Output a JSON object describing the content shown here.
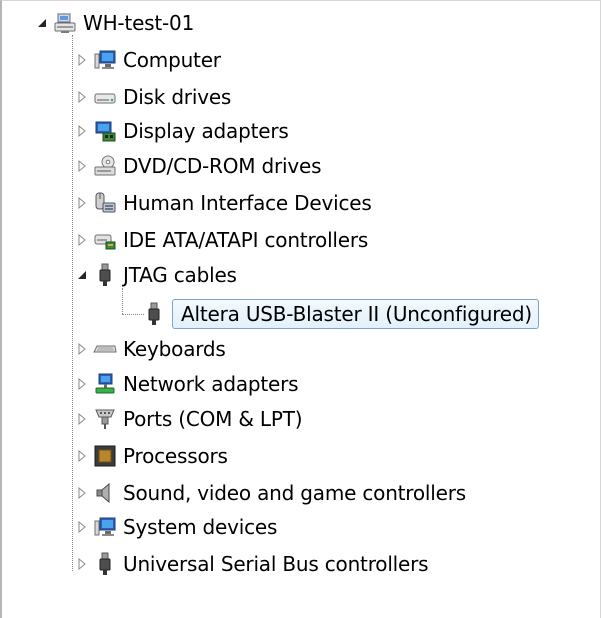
{
  "tree": {
    "root": {
      "label": "WH-test-01",
      "icon": "computer-tree-root-icon",
      "expanded": true
    },
    "items": [
      {
        "label": "Computer",
        "icon": "computer-icon"
      },
      {
        "label": "Disk drives",
        "icon": "disk-drive-icon"
      },
      {
        "label": "Display adapters",
        "icon": "display-adapter-icon"
      },
      {
        "label": "DVD/CD-ROM drives",
        "icon": "dvd-drive-icon"
      },
      {
        "label": "Human Interface Devices",
        "icon": "hid-icon"
      },
      {
        "label": "IDE ATA/ATAPI controllers",
        "icon": "ide-controller-icon"
      },
      {
        "label": "JTAG cables",
        "icon": "usb-plug-icon",
        "expanded": true
      },
      {
        "label": "Keyboards",
        "icon": "keyboard-icon"
      },
      {
        "label": "Network adapters",
        "icon": "network-adapter-icon"
      },
      {
        "label": "Ports (COM & LPT)",
        "icon": "port-icon"
      },
      {
        "label": "Processors",
        "icon": "processor-icon"
      },
      {
        "label": "Sound, video and game controllers",
        "icon": "speaker-icon"
      },
      {
        "label": "System devices",
        "icon": "system-device-icon"
      },
      {
        "label": "Universal Serial Bus controllers",
        "icon": "usb-plug-icon"
      }
    ],
    "jtag_child": {
      "label": "Altera USB-Blaster II (Unconfigured)",
      "icon": "usb-plug-icon",
      "selected": true
    }
  },
  "colors": {
    "selection_border": "#7da2ce",
    "selection_fill": "#e3f0fb"
  }
}
